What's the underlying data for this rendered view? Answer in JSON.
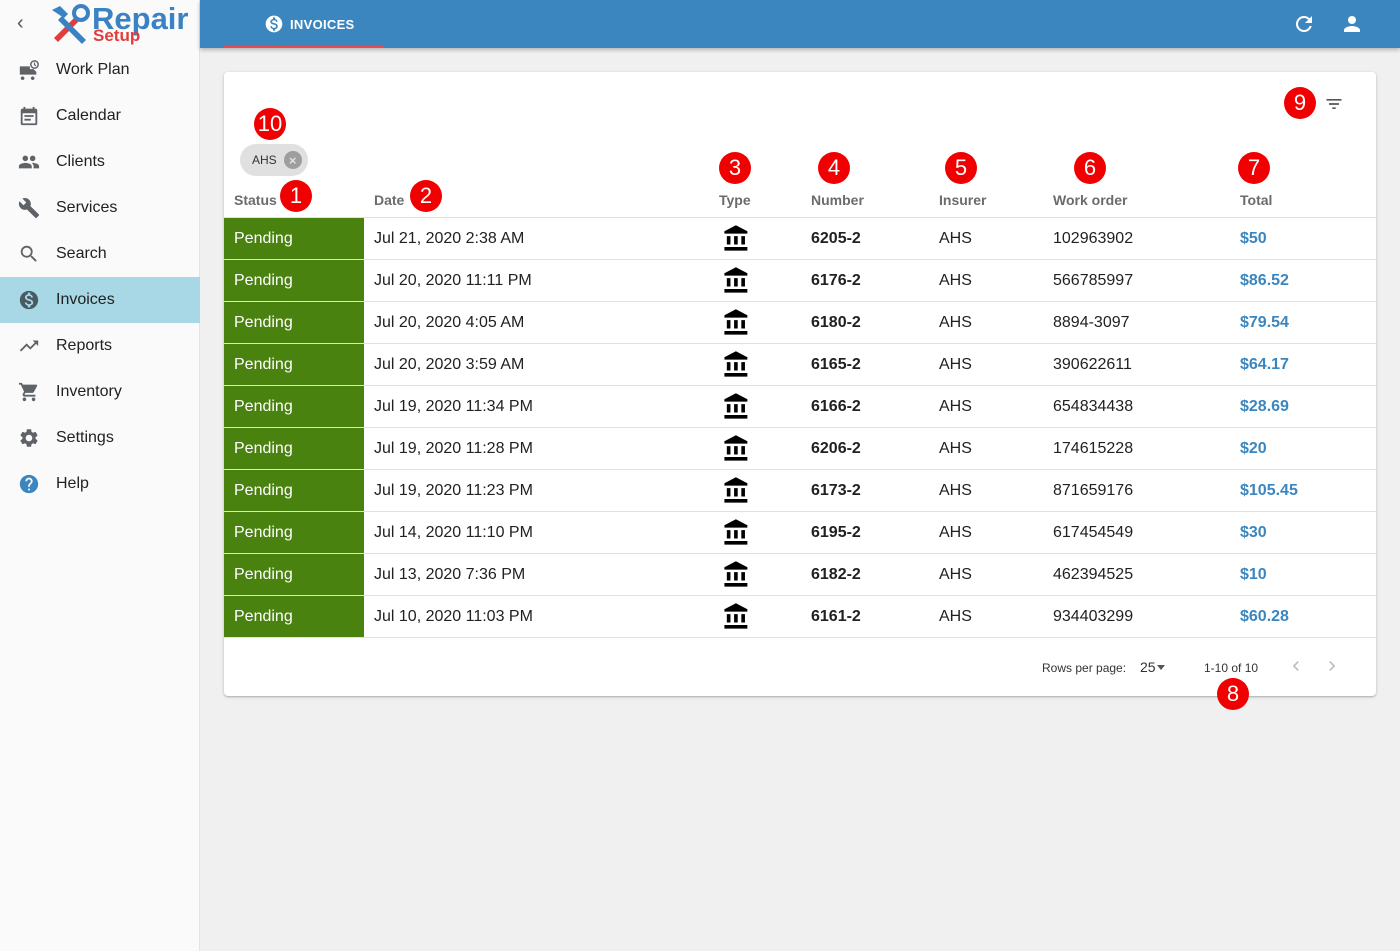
{
  "app": {
    "logo_main": "Repair",
    "logo_sub": "Setup"
  },
  "sidebar": {
    "items": [
      {
        "label": "Work Plan",
        "icon": "work-plan-icon",
        "active": false
      },
      {
        "label": "Calendar",
        "icon": "calendar-icon",
        "active": false
      },
      {
        "label": "Clients",
        "icon": "clients-icon",
        "active": false
      },
      {
        "label": "Services",
        "icon": "wrench-icon",
        "active": false
      },
      {
        "label": "Search",
        "icon": "search-icon",
        "active": false
      },
      {
        "label": "Invoices",
        "icon": "dollar-icon",
        "active": true
      },
      {
        "label": "Reports",
        "icon": "trending-up-icon",
        "active": false
      },
      {
        "label": "Inventory",
        "icon": "cart-icon",
        "active": false
      },
      {
        "label": "Settings",
        "icon": "gear-icon",
        "active": false
      },
      {
        "label": "Help",
        "icon": "help-icon",
        "active": false
      }
    ]
  },
  "topbar": {
    "tab_label": "INVOICES"
  },
  "filter": {
    "chip_label": "AHS"
  },
  "table": {
    "headers": {
      "status": "Status",
      "date": "Date",
      "type": "Type",
      "number": "Number",
      "insurer": "Insurer",
      "work_order": "Work order",
      "total": "Total"
    },
    "rows": [
      {
        "status": "Pending",
        "date": "Jul 21, 2020 2:38 AM",
        "number": "6205-2",
        "insurer": "AHS",
        "work_order": "102963902",
        "total": "$50"
      },
      {
        "status": "Pending",
        "date": "Jul 20, 2020 11:11 PM",
        "number": "6176-2",
        "insurer": "AHS",
        "work_order": "566785997",
        "total": "$86.52"
      },
      {
        "status": "Pending",
        "date": "Jul 20, 2020 4:05 AM",
        "number": "6180-2",
        "insurer": "AHS",
        "work_order": "8894-3097",
        "total": "$79.54"
      },
      {
        "status": "Pending",
        "date": "Jul 20, 2020 3:59 AM",
        "number": "6165-2",
        "insurer": "AHS",
        "work_order": "390622611",
        "total": "$64.17"
      },
      {
        "status": "Pending",
        "date": "Jul 19, 2020 11:34 PM",
        "number": "6166-2",
        "insurer": "AHS",
        "work_order": "654834438",
        "total": "$28.69"
      },
      {
        "status": "Pending",
        "date": "Jul 19, 2020 11:28 PM",
        "number": "6206-2",
        "insurer": "AHS",
        "work_order": "174615228",
        "total": "$20"
      },
      {
        "status": "Pending",
        "date": "Jul 19, 2020 11:23 PM",
        "number": "6173-2",
        "insurer": "AHS",
        "work_order": "871659176",
        "total": "$105.45"
      },
      {
        "status": "Pending",
        "date": "Jul 14, 2020 11:10 PM",
        "number": "6195-2",
        "insurer": "AHS",
        "work_order": "617454549",
        "total": "$30"
      },
      {
        "status": "Pending",
        "date": "Jul 13, 2020 7:36 PM",
        "number": "6182-2",
        "insurer": "AHS",
        "work_order": "462394525",
        "total": "$10"
      },
      {
        "status": "Pending",
        "date": "Jul 10, 2020 11:03 PM",
        "number": "6161-2",
        "insurer": "AHS",
        "work_order": "934403299",
        "total": "$60.28"
      }
    ]
  },
  "pagination": {
    "rows_per_page_label": "Rows per page:",
    "rows_per_page_value": "25",
    "range": "1-10 of 10"
  },
  "markers": [
    "1",
    "2",
    "3",
    "4",
    "5",
    "6",
    "7",
    "8",
    "9",
    "10"
  ],
  "colors": {
    "topbar": "#3b86bf",
    "status_pending": "#4a8210",
    "total": "#3b86bf",
    "active_nav": "#a8d8e6",
    "marker": "#f00000"
  }
}
